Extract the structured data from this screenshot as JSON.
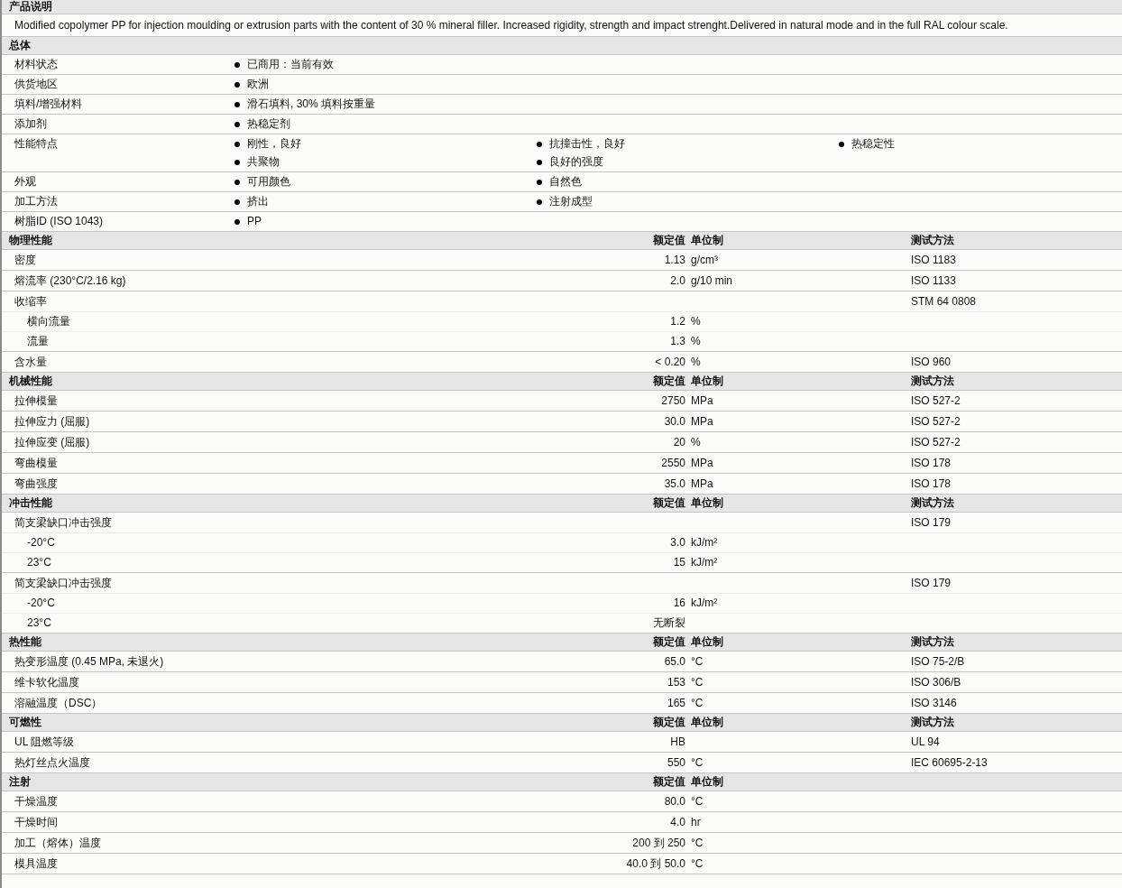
{
  "description": {
    "title": "产品说明",
    "text": "Modified copolymer PP for injection moulding or extrusion parts with the content of 30 % mineral filler. Increased rigidity, strength and impact strenght.Delivered in natural mode and in the full RAL colour scale."
  },
  "general": {
    "title": "总体",
    "rows": [
      {
        "label": "材料状态",
        "items": [
          "已商用：当前有效"
        ]
      },
      {
        "label": "供货地区",
        "items": [
          "欧洲"
        ]
      },
      {
        "label": "填料/增强材料",
        "items": [
          "滑石填料, 30% 填料按重量"
        ]
      },
      {
        "label": "添加剂",
        "items": [
          "热稳定剂"
        ]
      },
      {
        "label": "性能特点",
        "items": [
          "刚性，良好",
          "抗撞击性，良好",
          "热稳定性",
          "共聚物",
          "良好的强度"
        ]
      },
      {
        "label": "外观",
        "items": [
          "可用颜色",
          "自然色"
        ]
      },
      {
        "label": "加工方法",
        "items": [
          "挤出",
          "注射成型"
        ]
      },
      {
        "label": "树脂ID (ISO 1043)",
        "items": [
          "PP"
        ]
      }
    ]
  },
  "sections": [
    {
      "title": "物理性能",
      "value_header": "额定值",
      "unit_header": "单位制",
      "method_header": "测试方法",
      "rows": [
        {
          "label": "密度",
          "value": "1.13",
          "unit": "g/cm³",
          "method": "ISO 1183"
        },
        {
          "label": "熔流率  (230°C/2.16 kg)",
          "value": "2.0",
          "unit": "g/10 min",
          "method": "ISO 1133"
        },
        {
          "label": "收缩率",
          "method": "STM 64 0808",
          "children": [
            {
              "label": "横向流量",
              "value": "1.2",
              "unit": "%"
            },
            {
              "label": "流量",
              "value": "1.3",
              "unit": "%"
            }
          ]
        },
        {
          "label": "含水量",
          "value": "< 0.20",
          "unit": "%",
          "method": "ISO 960"
        }
      ]
    },
    {
      "title": "机械性能",
      "value_header": "额定值",
      "unit_header": "单位制",
      "method_header": "测试方法",
      "rows": [
        {
          "label": "拉伸模量",
          "value": "2750",
          "unit": "MPa",
          "method": "ISO 527-2"
        },
        {
          "label": "拉伸应力  (屈服)",
          "value": "30.0",
          "unit": "MPa",
          "method": "ISO 527-2"
        },
        {
          "label": "拉伸应变  (屈服)",
          "value": "20",
          "unit": "%",
          "method": "ISO 527-2"
        },
        {
          "label": "弯曲模量",
          "value": "2550",
          "unit": "MPa",
          "method": "ISO 178"
        },
        {
          "label": "弯曲强度",
          "value": "35.0",
          "unit": "MPa",
          "method": "ISO 178"
        }
      ]
    },
    {
      "title": "冲击性能",
      "value_header": "额定值",
      "unit_header": "单位制",
      "method_header": "测试方法",
      "rows": [
        {
          "label": "简支梁缺口冲击强度",
          "method": "ISO 179",
          "children": [
            {
              "label": "-20°C",
              "value": "3.0",
              "unit": "kJ/m²"
            },
            {
              "label": "23°C",
              "value": "15",
              "unit": "kJ/m²"
            }
          ]
        },
        {
          "label": "简支梁缺口冲击强度",
          "method": "ISO 179",
          "children": [
            {
              "label": "-20°C",
              "value": "16",
              "unit": "kJ/m²"
            },
            {
              "label": "23°C",
              "value": "无断裂"
            }
          ]
        }
      ]
    },
    {
      "title": "热性能",
      "value_header": "额定值",
      "unit_header": "单位制",
      "method_header": "测试方法",
      "rows": [
        {
          "label": "热变形温度  (0.45 MPa, 未退火)",
          "value": "65.0",
          "unit": "°C",
          "method": "ISO 75-2/B"
        },
        {
          "label": "维卡软化温度",
          "value": "153",
          "unit": "°C",
          "method": "ISO 306/B"
        },
        {
          "label": "溶融温度（DSC）",
          "value": "165",
          "unit": "°C",
          "method": "ISO 3146"
        }
      ]
    },
    {
      "title": "可燃性",
      "value_header": "额定值",
      "unit_header": "单位制",
      "method_header": "测试方法",
      "rows": [
        {
          "label": "UL 阻燃等级",
          "value": "HB",
          "method": "UL 94"
        },
        {
          "label": "热灯丝点火温度",
          "value": "550",
          "unit": "°C",
          "method": "IEC 60695-2-13"
        }
      ]
    },
    {
      "title": "注射",
      "value_header": "额定值",
      "unit_header": "单位制",
      "rows": [
        {
          "label": "干燥温度",
          "value": "80.0",
          "unit": "°C"
        },
        {
          "label": "干燥时间",
          "value": "4.0",
          "unit": "hr"
        },
        {
          "label": "加工（熔体）温度",
          "value": "200 到  250",
          "unit": "°C"
        },
        {
          "label": "模具温度",
          "value": "40.0 到  50.0",
          "unit": "°C"
        }
      ]
    }
  ]
}
